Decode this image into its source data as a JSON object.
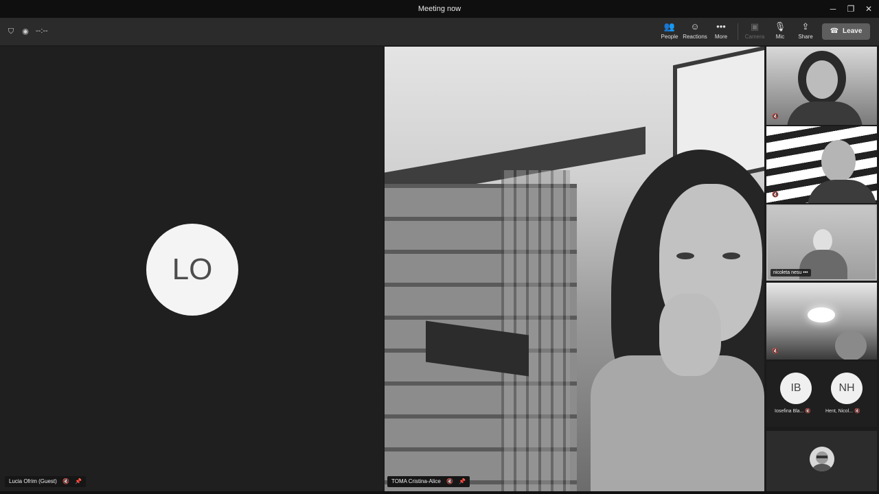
{
  "window": {
    "title": "Meeting now",
    "minimize_label": "─",
    "restore_label": "❐",
    "close_label": "✕"
  },
  "toolbar": {
    "left_status": "--:--",
    "left_icons": [
      "shield-icon",
      "record-status-icon"
    ],
    "buttons": [
      {
        "label": "People",
        "icon": "people-icon",
        "glyph": "👥"
      },
      {
        "label": "Reactions",
        "icon": "reactions-icon",
        "glyph": "☺"
      },
      {
        "label": "More",
        "icon": "more-icon",
        "glyph": "•••"
      },
      {
        "label": "Camera",
        "icon": "camera-off-icon",
        "glyph": "▣",
        "disabled": true
      },
      {
        "label": "Mic",
        "icon": "mic-off-icon",
        "glyph": "🎙"
      },
      {
        "label": "Share",
        "icon": "share-icon",
        "glyph": "⇪"
      }
    ],
    "leave_label": "Leave",
    "leave_icon_glyph": "☎"
  },
  "stage": {
    "left_tile": {
      "initials": "LO",
      "name": "Lucia Ofrim (Guest)",
      "mic_glyph": "🔇",
      "pin_glyph": "📌"
    },
    "main_video": {
      "name": "TOMA Cristina-Alice",
      "mic_glyph": "🔇",
      "pin_glyph": "📌"
    }
  },
  "gallery": {
    "tile3_name": "nicoleta nesu",
    "tile3_more": "•••",
    "mic_glyph": "🔇",
    "avatars": [
      {
        "initials": "IB",
        "label": "Iosefina Bla...",
        "mic_glyph": "🔇"
      },
      {
        "initials": "NH",
        "label": "Hent, Nicol...",
        "mic_glyph": "🔇"
      }
    ]
  },
  "colors": {
    "background": "#1b1b1b",
    "titlebar": "#0f0f0f",
    "toolbar": "#2b2b2b",
    "leave_button": "#5e5e5e"
  }
}
